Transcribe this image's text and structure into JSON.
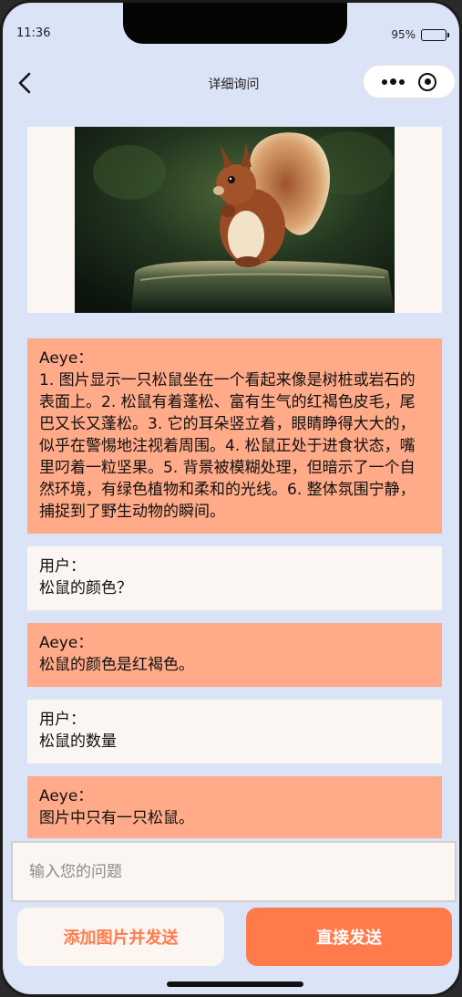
{
  "status": {
    "time": "11:36",
    "battery": "95%"
  },
  "navbar": {
    "title": "详细询问"
  },
  "messages": [
    {
      "role": "ai",
      "speaker": "Aeye：",
      "text": "1. 图片显示一只松鼠坐在一个看起来像是树桩或岩石的表面上。2. 松鼠有着蓬松、富有生气的红褐色皮毛，尾巴又长又蓬松。3. 它的耳朵竖立着，眼睛睁得大大的，似乎在警惕地注视着周围。4. 松鼠正处于进食状态，嘴里叼着一粒坚果。5. 背景被模糊处理，但暗示了一个自然环境，有绿色植物和柔和的光线。6. 整体氛围宁静，捕捉到了野生动物的瞬间。"
    },
    {
      "role": "user",
      "speaker": "用户：",
      "text": "松鼠的颜色？"
    },
    {
      "role": "ai",
      "speaker": "Aeye：",
      "text": "松鼠的颜色是红褐色。"
    },
    {
      "role": "user",
      "speaker": "用户：",
      "text": "松鼠的数量"
    },
    {
      "role": "ai",
      "speaker": "Aeye：",
      "text": "图片中只有一只松鼠。"
    }
  ],
  "input": {
    "placeholder": "输入您的问题",
    "value": ""
  },
  "buttons": {
    "add_image_send": "添加图片并发送",
    "direct_send": "直接发送"
  },
  "colors": {
    "accent": "#ff7b4c",
    "ai_bubble": "#ffaa88",
    "user_bubble": "#fbf6f2",
    "background": "#dbe3f7"
  },
  "icons": {
    "back": "chevron-left-icon",
    "more": "more-dots-icon",
    "close": "target-circle-icon"
  }
}
